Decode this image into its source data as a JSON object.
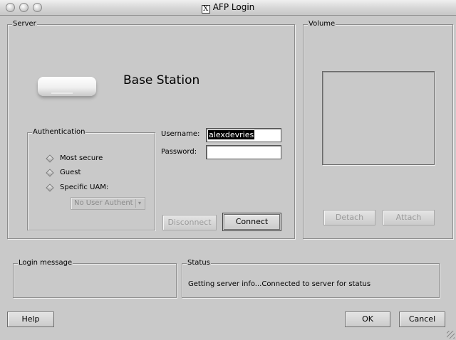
{
  "window": {
    "title": "AFP Login"
  },
  "server": {
    "label": "Server",
    "station_name": "Base Station",
    "authentication": {
      "label": "Authentication",
      "options": [
        "Most secure",
        "Guest",
        "Specific UAM:"
      ],
      "uam_select_value": "No User Authent"
    },
    "username_label": "Username:",
    "username_value": "alexdevries",
    "password_label": "Password:",
    "password_value": "",
    "disconnect_label": "Disconnect",
    "connect_label": "Connect"
  },
  "volume": {
    "label": "Volume",
    "detach_label": "Detach",
    "attach_label": "Attach"
  },
  "login_message": {
    "label": "Login message",
    "text": ""
  },
  "status": {
    "label": "Status",
    "text": "Getting server info...Connected to server for status"
  },
  "footer": {
    "help_label": "Help",
    "ok_label": "OK",
    "cancel_label": "Cancel"
  }
}
